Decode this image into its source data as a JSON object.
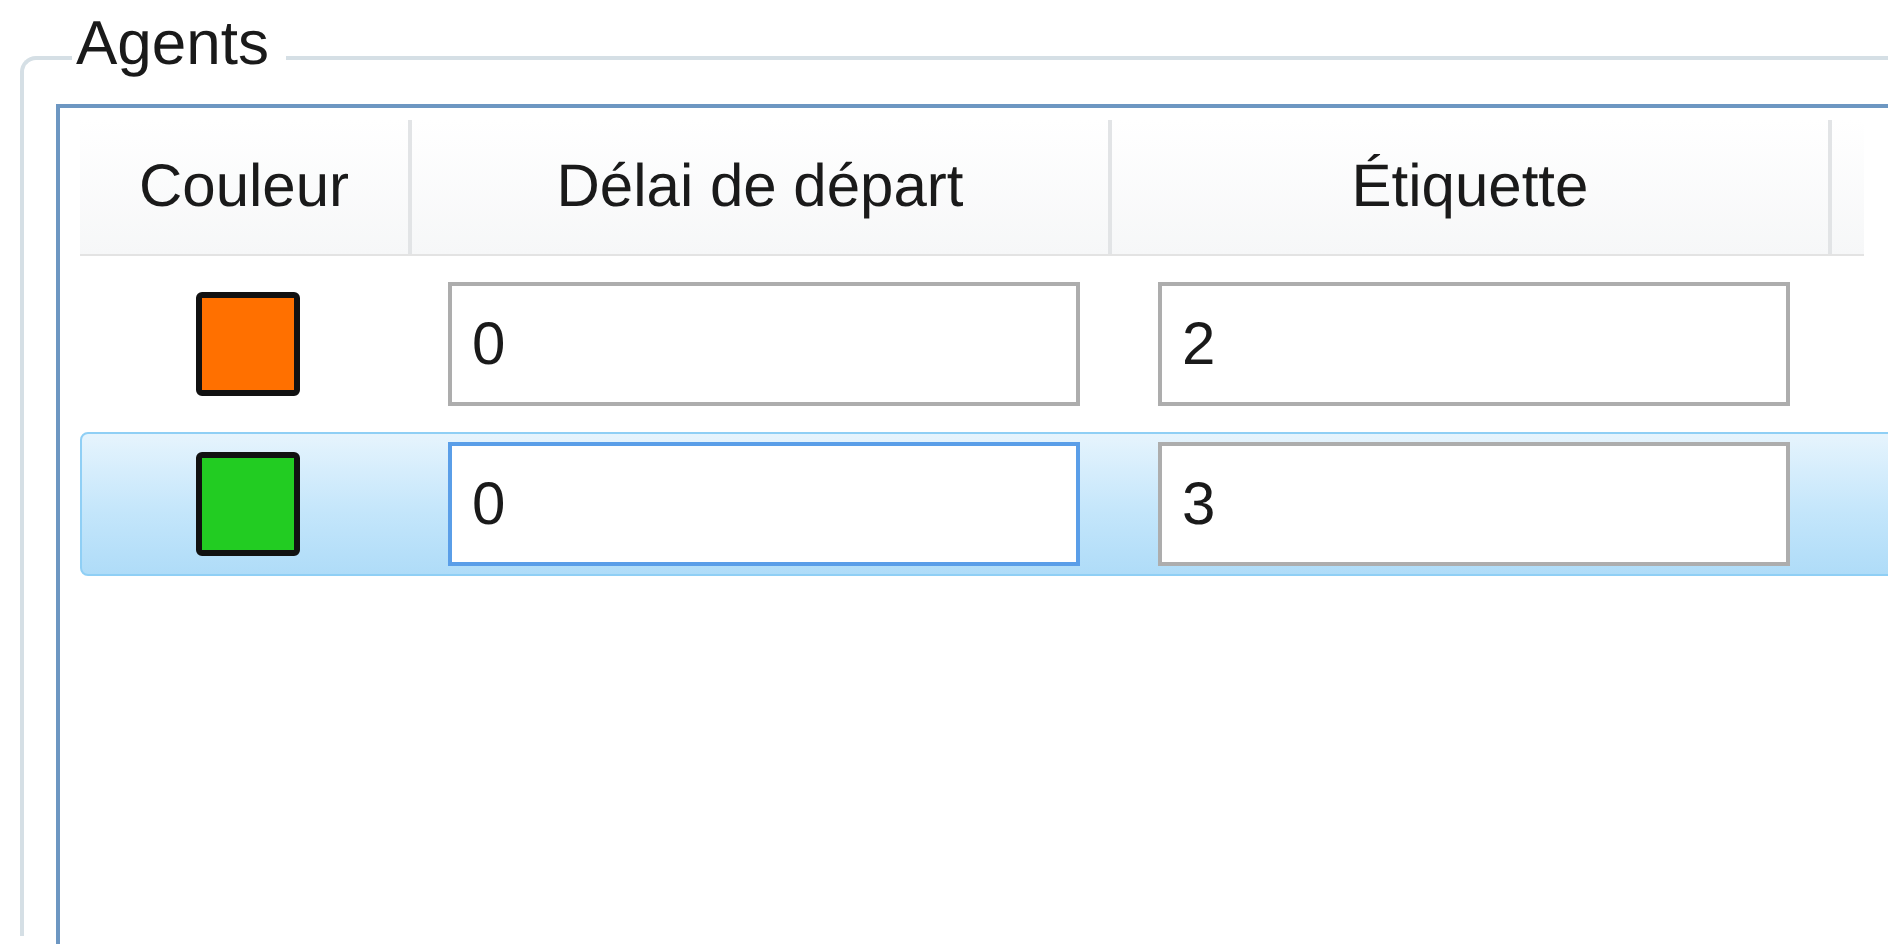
{
  "group": {
    "title": "Agents"
  },
  "table": {
    "columns": [
      "Couleur",
      "Délai de départ",
      "Étiquette"
    ],
    "rows": [
      {
        "color": "#ff7000",
        "selected": false,
        "delay": {
          "value": "0",
          "focused": false
        },
        "label": {
          "value": "2",
          "focused": false
        }
      },
      {
        "color": "#22cc22",
        "selected": true,
        "delay": {
          "value": "0",
          "focused": true
        },
        "label": {
          "value": "3",
          "focused": false
        }
      }
    ]
  }
}
